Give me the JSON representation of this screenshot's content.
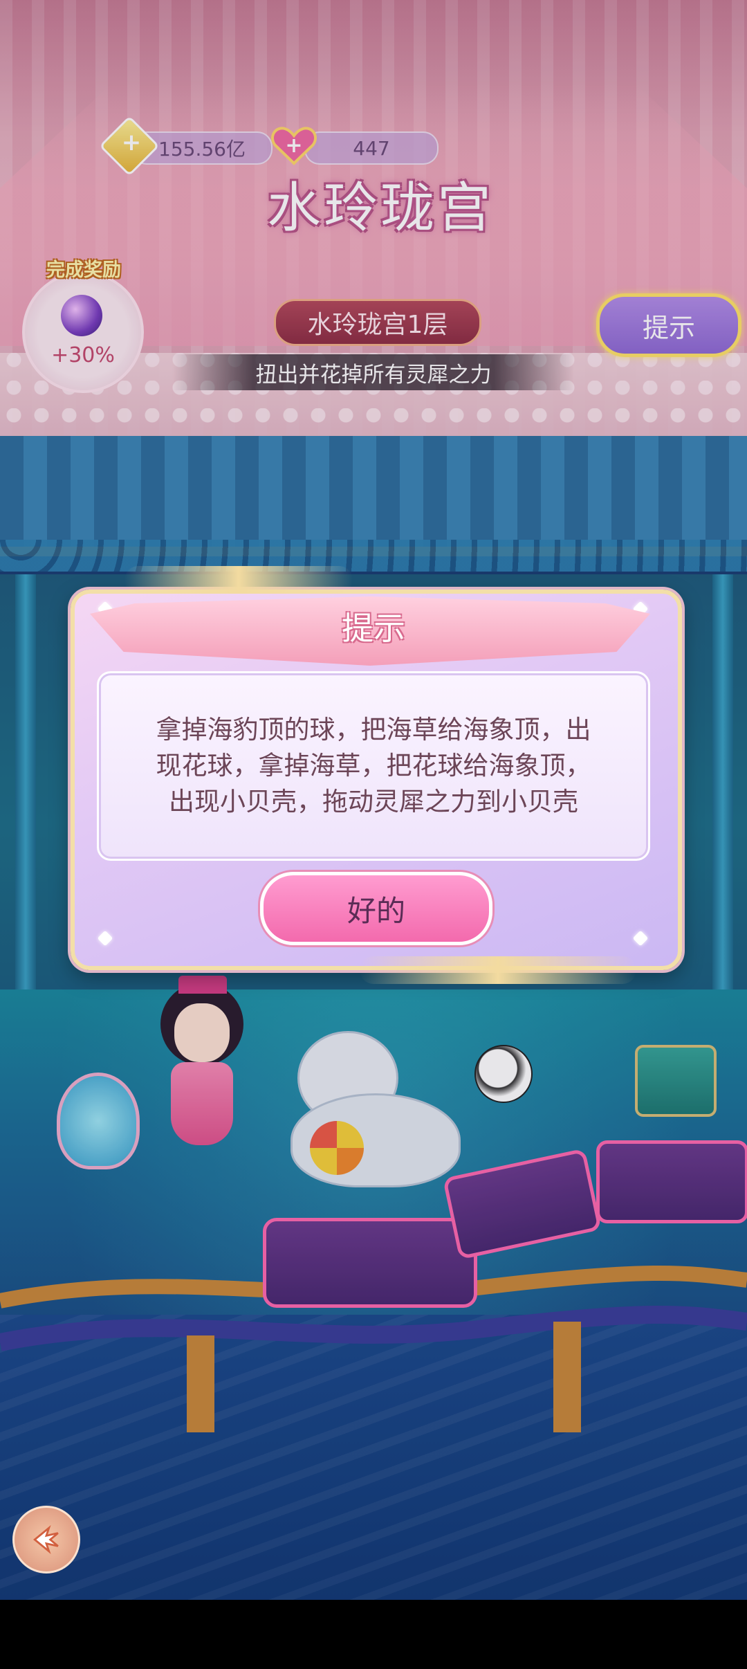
{
  "hud": {
    "diamonds": "155.56亿",
    "hearts": "447",
    "title": "水玲珑宫",
    "reward_label": "完成奖励",
    "reward_bonus": "+30%",
    "level": "水玲珑宫1层",
    "hint_button": "提示",
    "objective": "扭出并花掉所有灵犀之力"
  },
  "dialog": {
    "title": "提示",
    "message": "拿掉海豹顶的球，把海草给海象顶，出现花球，拿掉海草，把花球给海象顶，出现小贝壳，拖动灵犀之力到小贝壳",
    "ok_button": "好的"
  },
  "icons": {
    "diamond": "diamond-plus-icon",
    "heart": "heart-plus-icon",
    "back": "back-arrow-icon"
  },
  "colors": {
    "accent_pink": "#f36aad",
    "hint_yellow_border": "#ffe46a",
    "title_outline": "#b0507f"
  }
}
